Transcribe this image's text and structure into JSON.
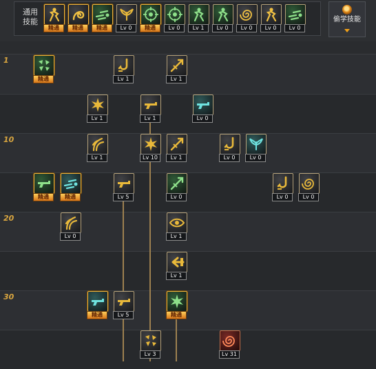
{
  "header": {
    "common_label": "通用\n技能",
    "steal_button_label": "偷学技能"
  },
  "level_markers": [
    "1",
    "10",
    "20",
    "30"
  ],
  "common_skills": [
    {
      "name": "common-skill-1-icon",
      "badge": "精通",
      "elite": true,
      "theme": "gold",
      "glyph": "figure"
    },
    {
      "name": "common-skill-2-icon",
      "badge": "精通",
      "elite": true,
      "theme": "gold",
      "glyph": "swirl"
    },
    {
      "name": "common-skill-3-icon",
      "badge": "精通",
      "elite": true,
      "theme": "green",
      "glyph": "dash"
    },
    {
      "name": "common-skill-4-icon",
      "badge": "Lv 0",
      "elite": false,
      "theme": "dark",
      "glyph": "wings"
    },
    {
      "name": "common-skill-5-icon",
      "badge": "精通",
      "elite": true,
      "theme": "green",
      "glyph": "target"
    },
    {
      "name": "common-skill-6-icon",
      "badge": "Lv 0",
      "elite": false,
      "theme": "green",
      "glyph": "target"
    },
    {
      "name": "common-skill-7-icon",
      "badge": "Lv 1",
      "elite": false,
      "theme": "green",
      "glyph": "figure"
    },
    {
      "name": "common-skill-8-icon",
      "badge": "Lv 0",
      "elite": false,
      "theme": "green",
      "glyph": "figure"
    },
    {
      "name": "common-skill-9-icon",
      "badge": "Lv 0",
      "elite": false,
      "theme": "gold",
      "glyph": "spiral"
    },
    {
      "name": "common-skill-10-icon",
      "badge": "Lv 0",
      "elite": false,
      "theme": "gold",
      "glyph": "figure"
    },
    {
      "name": "common-skill-11-icon",
      "badge": "Lv 0",
      "elite": false,
      "theme": "green",
      "glyph": "dash"
    }
  ],
  "tree_skills": [
    {
      "name": "skill-r1-a-icon",
      "badge": "精通",
      "elite": true,
      "theme": "green",
      "glyph": "shards"
    },
    {
      "name": "skill-r1-b-icon",
      "badge": "Lv 1",
      "elite": false,
      "theme": "dark",
      "glyph": "hook"
    },
    {
      "name": "skill-r1-c-icon",
      "badge": "Lv 1",
      "elite": false,
      "theme": "dark",
      "glyph": "slash"
    },
    {
      "name": "skill-r2-a-icon",
      "badge": "Lv 1",
      "elite": false,
      "theme": "dark",
      "glyph": "burst"
    },
    {
      "name": "skill-r2-b-icon",
      "badge": "Lv 1",
      "elite": false,
      "theme": "dark",
      "glyph": "gun"
    },
    {
      "name": "skill-r2-c-icon",
      "badge": "Lv 0",
      "elite": false,
      "theme": "teal",
      "glyph": "gun"
    },
    {
      "name": "skill-r3-a-icon",
      "badge": "Lv 1",
      "elite": false,
      "theme": "dark",
      "glyph": "claw"
    },
    {
      "name": "skill-r3-b-icon",
      "badge": "Lv 10",
      "elite": false,
      "theme": "dark",
      "glyph": "burst"
    },
    {
      "name": "skill-r3-c-icon",
      "badge": "Lv 1",
      "elite": false,
      "theme": "dark",
      "glyph": "slash"
    },
    {
      "name": "skill-r3-d-icon",
      "badge": "Lv 0",
      "elite": false,
      "theme": "dark",
      "glyph": "hook"
    },
    {
      "name": "skill-r3-e-icon",
      "badge": "Lv 0",
      "elite": false,
      "theme": "teal",
      "glyph": "wings"
    },
    {
      "name": "skill-r4-a-icon",
      "badge": "精通",
      "elite": true,
      "theme": "green",
      "glyph": "gun"
    },
    {
      "name": "skill-r4-b-icon",
      "badge": "精通",
      "elite": true,
      "theme": "teal",
      "glyph": "dash"
    },
    {
      "name": "skill-r4-c-icon",
      "badge": "Lv 5",
      "elite": false,
      "theme": "dark",
      "glyph": "gun"
    },
    {
      "name": "skill-r4-d-icon",
      "badge": "Lv 0",
      "elite": false,
      "theme": "green",
      "glyph": "slash"
    },
    {
      "name": "skill-r4-e-icon",
      "badge": "Lv 0",
      "elite": false,
      "theme": "dark",
      "glyph": "hook"
    },
    {
      "name": "skill-r4-f-icon",
      "badge": "Lv 0",
      "elite": false,
      "theme": "dark",
      "glyph": "spiral"
    },
    {
      "name": "skill-r5-a-icon",
      "badge": "Lv 0",
      "elite": false,
      "theme": "dark",
      "glyph": "claw"
    },
    {
      "name": "skill-r5-b-icon",
      "badge": "Lv 1",
      "elite": false,
      "theme": "dark",
      "glyph": "eye"
    },
    {
      "name": "skill-r6-a-icon",
      "badge": "Lv 1",
      "elite": false,
      "theme": "dark",
      "glyph": "arrow"
    },
    {
      "name": "skill-r7-a-icon",
      "badge": "精通",
      "elite": true,
      "theme": "teal",
      "glyph": "gun"
    },
    {
      "name": "skill-r7-b-icon",
      "badge": "Lv 5",
      "elite": false,
      "theme": "dark",
      "glyph": "gun"
    },
    {
      "name": "skill-r7-c-icon",
      "badge": "精通",
      "elite": true,
      "theme": "green",
      "glyph": "burst"
    },
    {
      "name": "skill-r8-a-icon",
      "badge": "Lv 3",
      "elite": false,
      "theme": "dark",
      "glyph": "shards"
    },
    {
      "name": "skill-r8-b-icon",
      "badge": "Lv 31",
      "elite": false,
      "theme": "red",
      "glyph": "spiral"
    }
  ]
}
